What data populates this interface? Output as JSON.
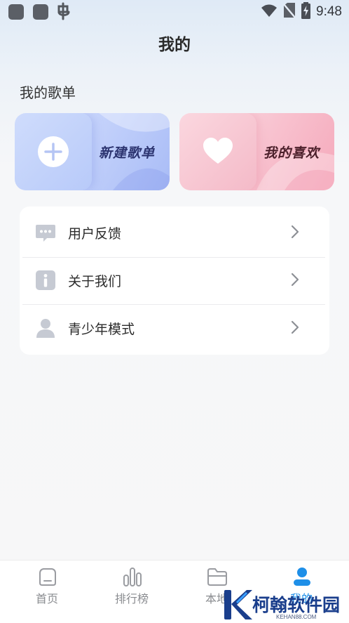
{
  "status_bar": {
    "time": "9:48",
    "icons": [
      "app-square-icon",
      "app-square-icon",
      "bug-icon",
      "wifi-icon",
      "no-sim-icon",
      "battery-charging-icon"
    ]
  },
  "header": {
    "title": "我的"
  },
  "playlists": {
    "section_title": "我的歌单",
    "cards": [
      {
        "label": "新建歌单",
        "icon": "plus-icon"
      },
      {
        "label": "我的喜欢",
        "icon": "heart-icon"
      }
    ]
  },
  "menu": {
    "items": [
      {
        "label": "用户反馈",
        "icon": "chat-icon"
      },
      {
        "label": "关于我们",
        "icon": "info-icon"
      },
      {
        "label": "青少年模式",
        "icon": "person-icon"
      }
    ]
  },
  "tab_bar": {
    "tabs": [
      {
        "label": "首页",
        "icon": "home-icon",
        "active": false
      },
      {
        "label": "排行榜",
        "icon": "bar-chart-icon",
        "active": false
      },
      {
        "label": "本地",
        "icon": "folder-icon",
        "active": false
      },
      {
        "label": "我的",
        "icon": "profile-icon",
        "active": true
      }
    ]
  },
  "watermark": {
    "text": "柯翰软件园",
    "sub": "KEHAN88.COM"
  },
  "colors": {
    "accent": "#1e8fe8",
    "icon_gray": "#c6cad3",
    "text_dark": "#2b2b2b"
  }
}
